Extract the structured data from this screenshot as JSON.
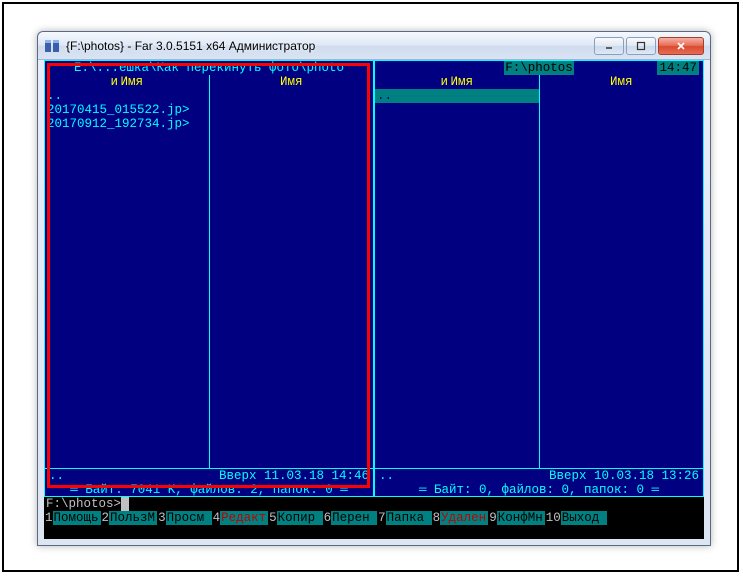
{
  "window": {
    "title": "{F:\\photos} - Far 3.0.5151 x64 Администратор"
  },
  "clock": "14:47",
  "left_panel": {
    "path": "E:\\...ешка\\Как перекинуть фото\\photo",
    "col_short": "и",
    "col_name": "Имя",
    "files": {
      "updir": "..",
      "f1": "20170415_015522.jp",
      "f1s": ">",
      "f2": "20170912_192734.jp",
      "f2s": ">"
    },
    "status_current": "..",
    "status_date": "Вверх 11.03.18 14:46",
    "status_info": "Байт: 7041 K, файлов: 2, папок: 0",
    "status_right": "═"
  },
  "right_panel": {
    "path": "F:\\photos",
    "col_short": "и",
    "col_name": "Имя",
    "files": {
      "updir": ".."
    },
    "status_current": "..",
    "status_date": "Вверх 10.03.18 13:26",
    "status_info": "Байт: 0, файлов: 0, папок: 0",
    "status_right": "═"
  },
  "cmdline": {
    "prompt": "F:\\photos>"
  },
  "keybar": {
    "k1n": "1",
    "k1l": "Помощь",
    "k2n": "2",
    "k2l": "ПользМ",
    "k3n": "3",
    "k3l": "Просм",
    "k4n": "4",
    "k4l": "Редакт",
    "k5n": "5",
    "k5l": "Копир",
    "k6n": "6",
    "k6l": "Перен",
    "k7n": "7",
    "k7l": "Папка",
    "k8n": "8",
    "k8l": "Удален",
    "k9n": "9",
    "k9l": "КонфМн",
    "k10n": "10",
    "k10l": "Выход"
  }
}
